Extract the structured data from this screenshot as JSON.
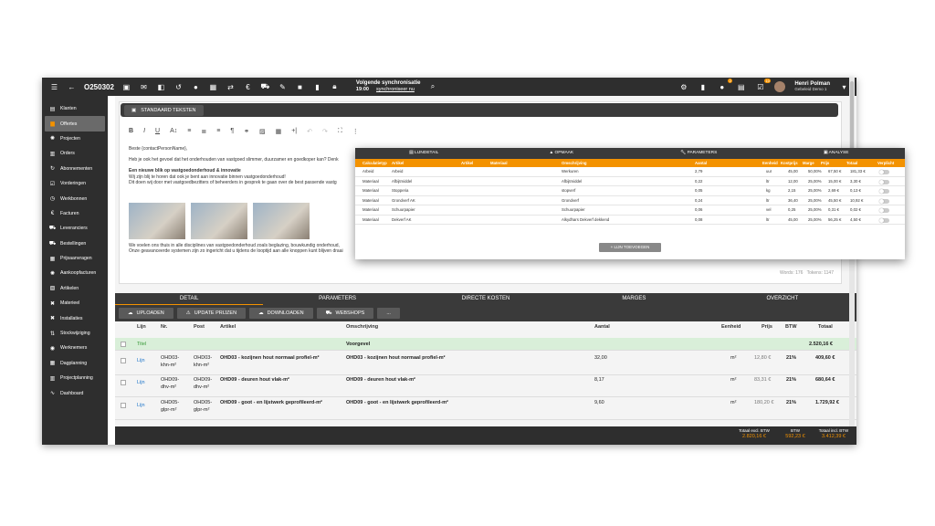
{
  "topbar": {
    "code": "O250302",
    "sync_title": "Volgende synchronisatie",
    "sync_time": "19:00",
    "sync_link": "synchroniseer nu",
    "notif1": "2",
    "notif2": "10",
    "user_name": "Henri Polman",
    "user_company": "Gebeleid Demo 1"
  },
  "sidebar": {
    "items": [
      {
        "label": "Klanten",
        "icon": "contacts-icon"
      },
      {
        "label": "Offertes",
        "icon": "folder-icon"
      },
      {
        "label": "Projecten",
        "icon": "gear-icon"
      },
      {
        "label": "Orders",
        "icon": "orders-icon"
      },
      {
        "label": "Abonnementen",
        "icon": "refresh-icon"
      },
      {
        "label": "Vorderingen",
        "icon": "check-icon"
      },
      {
        "label": "Werkbonnen",
        "icon": "clock-icon"
      },
      {
        "label": "Facturen",
        "icon": "euro-icon"
      },
      {
        "label": "Leveranciers",
        "icon": "truck-icon"
      },
      {
        "label": "Bestellingen",
        "icon": "cart-icon"
      },
      {
        "label": "Prijsaanvragen",
        "icon": "document-icon"
      },
      {
        "label": "Aankoopfacturen",
        "icon": "gear-icon"
      },
      {
        "label": "Artikelen",
        "icon": "box-icon"
      },
      {
        "label": "Materieel",
        "icon": "tools-icon"
      },
      {
        "label": "Installaties",
        "icon": "wrench-icon"
      },
      {
        "label": "Stockwijziging",
        "icon": "stock-icon"
      },
      {
        "label": "Werknemers",
        "icon": "users-icon"
      },
      {
        "label": "Dagplanning",
        "icon": "calendar-icon"
      },
      {
        "label": "Projectplanning",
        "icon": "planning-icon"
      },
      {
        "label": "Dashboard",
        "icon": "chart-icon"
      }
    ]
  },
  "editor": {
    "std_button": "STANDAARD TEKSTEN",
    "greeting": "Beste {contactPersonName},",
    "p1": "Heb je ook het gevoel dat het onderhouden van vastgoed slimmer, duurzamer en goedkoper kan? Denk",
    "heading": "Een nieuwe blik op vastgoedonderhoud & innovatie",
    "p2a": "Wij zijn blij te horen dat ook je bent aan innovatie binnen vastgoedonderhoud!",
    "p2b": "Dit doen wij door met vastgoedbezitters of beheerders in gesprek te gaan over de best passende vastg",
    "p3a": "We voelen ons thuis in alle disciplines van vastgoedonderhoud zoals beglazing, bouwkundig onderhoud,",
    "p3b": "Onze geavanceerde systemen zijn zo ingericht dat u tijdens de looptijd aan alle knoppen kunt blijven draai",
    "words": "Words: 176",
    "tokens": "Tokens: 1147"
  },
  "tabs": [
    "DETAIL",
    "PARAMETERS",
    "DIRECTE KOSTEN",
    "MARGES",
    "OVERZICHT"
  ],
  "actions": [
    "UPLOADEN",
    "UPDATE PRIJZEN",
    "DOWNLOADEN",
    "WEBSHOPS",
    "..."
  ],
  "table": {
    "headers": {
      "lijn": "Lijn",
      "nr": "Nr.",
      "post": "Post",
      "artikel": "Artikel",
      "omschrijving": "Omschrijving",
      "aantal": "Aantal",
      "eenheid": "Eenheid",
      "prijs": "Prijs",
      "btw": "BTW",
      "totaal": "Totaal"
    },
    "title_row": {
      "label": "Titel",
      "omschrijving": "Voorgevel",
      "totaal": "2.520,16 €"
    },
    "rows": [
      {
        "lijn": "Lijn",
        "nr1": "OHD03-",
        "nr2": "khn-m²",
        "post1": "OHD03-",
        "post2": "khn-m²",
        "artikel": "OHD03 - kozijnen hout normaal profiel-m²",
        "omschrijving": "OHD03 - kozijnen hout normaal profiel-m²",
        "aantal": "32,00",
        "eenheid": "m²",
        "prijs": "12,80 €",
        "btw": "21%",
        "totaal": "409,60 €"
      },
      {
        "lijn": "Lijn",
        "nr1": "OHD09-",
        "nr2": "dhv-m²",
        "post1": "OHD09-",
        "post2": "dhv-m²",
        "artikel": "OHD09 - deuren hout vlak-m²",
        "omschrijving": "OHD09 - deuren hout vlak-m²",
        "aantal": "8,17",
        "eenheid": "m²",
        "prijs": "83,31 €",
        "btw": "21%",
        "totaal": "680,64 €"
      },
      {
        "lijn": "Lijn",
        "nr1": "OHD05-",
        "nr2": "glpr-m²",
        "post1": "OHD05-",
        "post2": "glpr-m²",
        "artikel": "OHD09 - goot - en lijstwerk geprofileerd-m²",
        "omschrijving": "OHD09 - goot - en lijstwerk geprofileerd-m²",
        "aantal": "9,60",
        "eenheid": "m²",
        "prijs": "180,20 €",
        "btw": "21%",
        "totaal": "1.729,92 €"
      }
    ]
  },
  "footer": {
    "excl_label": "Totaal excl. BTW",
    "excl_value": "2.820,16 €",
    "btw_label": "BTW",
    "btw_value": "592,23 €",
    "incl_label": "Totaal incl. BTW",
    "incl_value": "3.412,39 €"
  },
  "popup": {
    "tabs": [
      "LIJNDETAIL",
      "OPMAAK",
      "PARAMETERS",
      "ANALYSE"
    ],
    "headers": [
      "Calculatietyp",
      "Artikel",
      "Artikel",
      "Materiaal",
      "Omschrijving",
      "Aantal",
      "Eenheid",
      "Kostprijs",
      "Marge",
      "Prijs",
      "Totaal",
      "Verplicht"
    ],
    "rows": [
      {
        "type": "Arbeid",
        "artikel": "Arbeid",
        "omschrijving": "Werkuren",
        "aantal": "2,79",
        "eenheid": "uur",
        "kost": "45,00",
        "marge": "50,00%",
        "prijs": "67,50 €",
        "totaal": "181,33 €"
      },
      {
        "type": "Materiaal",
        "artikel": "Afbijtmiddel",
        "omschrijving": "Afbijtmiddel",
        "aantal": "0,22",
        "eenheid": "ltr",
        "kost": "12,00",
        "marge": "25,00%",
        "prijs": "15,00 €",
        "totaal": "3,30 €"
      },
      {
        "type": "Materiaal",
        "artikel": "Stopperia",
        "omschrijving": "stopverf",
        "aantal": "0,05",
        "eenheid": "kg",
        "kost": "2,15",
        "marge": "25,00%",
        "prijs": "2,69 €",
        "totaal": "0,13 €"
      },
      {
        "type": "Materiaal",
        "artikel": "Grondverf AK",
        "omschrijving": "Grondverf",
        "aantal": "0,24",
        "eenheid": "ltr",
        "kost": "36,40",
        "marge": "25,00%",
        "prijs": "45,50 €",
        "totaal": "10,92 €"
      },
      {
        "type": "Materiaal",
        "artikel": "Schuurpapier",
        "omschrijving": "Schuurpapier",
        "aantal": "0,06",
        "eenheid": "vel",
        "kost": "0,25",
        "marge": "25,00%",
        "prijs": "0,31 €",
        "totaal": "0,02 €"
      },
      {
        "type": "Materiaal",
        "artikel": "Dekverf AK",
        "omschrijving": "Alkydhars Dekverf dekkend",
        "aantal": "0,08",
        "eenheid": "ltr",
        "kost": "45,00",
        "marge": "25,00%",
        "prijs": "56,25 €",
        "totaal": "4,50 €"
      }
    ],
    "add_button": "+ LIJN TOEVOEGEN"
  },
  "colors": {
    "accent": "#f39200",
    "dark": "#2e2e2e",
    "title_row": "#d9efd9"
  }
}
